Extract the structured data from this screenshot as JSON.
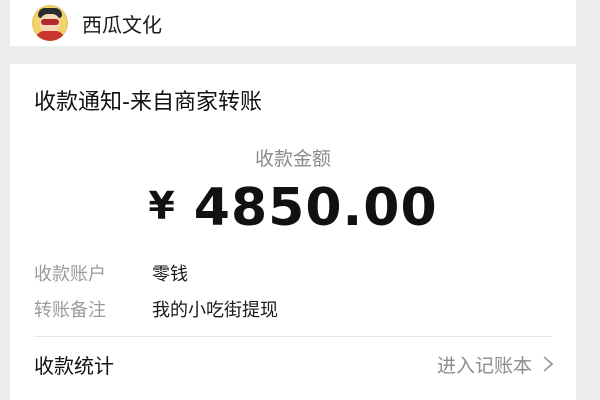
{
  "header": {
    "brand": "西瓜文化",
    "avatar_icon": "cartoon-avatar"
  },
  "notice": {
    "title": "收款通知-来自商家转账",
    "amount_label": "收款金额",
    "currency": "¥",
    "amount": "4850.00",
    "fields": [
      {
        "label": "收款账户",
        "value": "零钱"
      },
      {
        "label": "转账备注",
        "value": "我的小吃街提现"
      }
    ],
    "stats": {
      "label": "收款统计",
      "action": "进入记账本",
      "action_icon": "chevron-right-icon"
    }
  }
}
